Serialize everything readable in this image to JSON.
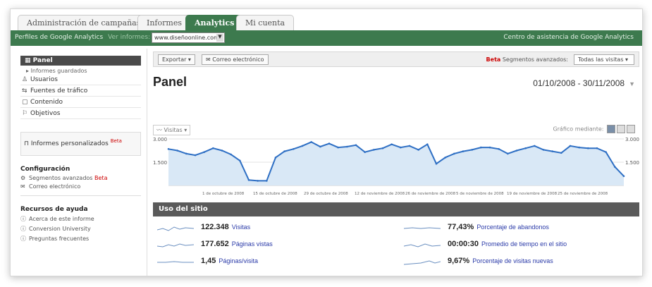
{
  "tabs": [
    "Administración de campañas",
    "Informes",
    "Analytics",
    "Mi cuenta"
  ],
  "greenbar": {
    "account_label": "Perfiles de Google Analytics",
    "profile_label": "Ver informes:",
    "site": "www.diseñoonline.com",
    "help_link": "Centro de asistencia de Google Analytics"
  },
  "sidebar": {
    "panel": "Panel",
    "sub_item": "Informes guardados",
    "items": [
      {
        "label": "Usuarios",
        "icon": "users-icon"
      },
      {
        "label": "Fuentes de tráfico",
        "icon": "traffic-icon"
      },
      {
        "label": "Contenido",
        "icon": "content-icon"
      },
      {
        "label": "Objetivos",
        "icon": "goals-icon"
      }
    ],
    "custom_reports": "Informes personalizados",
    "custom_badge": "Beta",
    "config_title": "Configuración",
    "config_items": [
      {
        "label": "Segmentos avanzados",
        "badge": "Beta"
      },
      {
        "label": "Correo electrónico",
        "badge": ""
      }
    ],
    "help_title": "Recursos de ayuda",
    "help_items": [
      "Acerca de este informe",
      "Conversion University",
      "Preguntas frecuentes"
    ]
  },
  "toolbar": {
    "export": "Exportar",
    "email": "Correo electrónico",
    "segment_badge": "Beta",
    "segment_label": "Segmentos avanzados:",
    "segment_value": "Todas las visitas"
  },
  "page_title": "Panel",
  "date_range": "01/10/2008 - 30/11/2008",
  "chart": {
    "series_label": "Visitas",
    "options_label": "Gráfico mediante:",
    "y_top": "3.000",
    "y_mid": "1.500",
    "x_labels": [
      "1 de octubre de 2008",
      "15 de octubre de 2008",
      "29 de octubre de 2008",
      "12 de noviembre de 2008",
      "26 de noviembre de 2008",
      "5 de noviembre de 2008",
      "19 de noviembre de 2008",
      "25 de noviembre de 2008"
    ]
  },
  "chart_data": {
    "type": "area",
    "series": [
      {
        "name": "Visitas",
        "values": [
          2350,
          2250,
          2050,
          1950,
          2150,
          2400,
          2250,
          2000,
          1600,
          350,
          300,
          300,
          1800,
          2200,
          2350,
          2550,
          2800,
          2500,
          2700,
          2450,
          2500,
          2600,
          2150,
          2300,
          2400,
          2650,
          2450,
          2550,
          2300,
          2650,
          1400,
          1800,
          2050,
          2200,
          2300,
          2450,
          2450,
          2350,
          2050,
          2250,
          2400,
          2550,
          2300,
          2200,
          2100,
          2550,
          2450,
          2400,
          2400,
          2150,
          1200,
          600
        ]
      }
    ],
    "ylim": [
      0,
      3000
    ]
  },
  "section_title": "Uso del sitio",
  "metrics": [
    {
      "value": "122.348",
      "label": "Visitas"
    },
    {
      "value": "177.652",
      "label": "Páginas vistas"
    },
    {
      "value": "1,45",
      "label": "Páginas/visita"
    },
    {
      "value": "77,43%",
      "label": "Porcentaje de abandonos"
    },
    {
      "value": "00:00:30",
      "label": "Promedio de tiempo en el sitio"
    },
    {
      "value": "9,67%",
      "label": "Porcentaje de visitas nuevas"
    }
  ]
}
